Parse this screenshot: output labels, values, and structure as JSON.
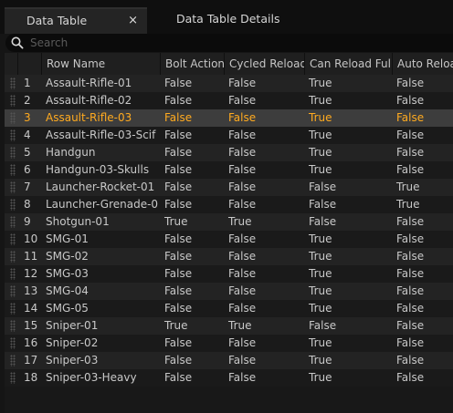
{
  "tabs": [
    {
      "label": "Data Table",
      "close": "×"
    },
    {
      "label": "Data Table Details"
    }
  ],
  "search": {
    "placeholder": "Search",
    "value": ""
  },
  "table": {
    "columns": [
      "Row Name",
      "Bolt Action",
      "Cycled Reload",
      "Can Reload Full",
      "Auto Reload"
    ],
    "selected_index": 2,
    "rows": [
      {
        "idx": "1",
        "name": "Assault-Rifle-01",
        "bolt": "False",
        "cycled": "False",
        "full": "True",
        "auto": "False"
      },
      {
        "idx": "2",
        "name": "Assault-Rifle-02",
        "bolt": "False",
        "cycled": "False",
        "full": "True",
        "auto": "False"
      },
      {
        "idx": "3",
        "name": "Assault-Rifle-03",
        "bolt": "False",
        "cycled": "False",
        "full": "True",
        "auto": "False"
      },
      {
        "idx": "4",
        "name": "Assault-Rifle-03-Scif",
        "bolt": "False",
        "cycled": "False",
        "full": "True",
        "auto": "False"
      },
      {
        "idx": "5",
        "name": "Handgun",
        "bolt": "False",
        "cycled": "False",
        "full": "True",
        "auto": "False"
      },
      {
        "idx": "6",
        "name": "Handgun-03-Skulls",
        "bolt": "False",
        "cycled": "False",
        "full": "True",
        "auto": "False"
      },
      {
        "idx": "7",
        "name": "Launcher-Rocket-01",
        "bolt": "False",
        "cycled": "False",
        "full": "False",
        "auto": "True"
      },
      {
        "idx": "8",
        "name": "Launcher-Grenade-0",
        "bolt": "False",
        "cycled": "False",
        "full": "False",
        "auto": "True"
      },
      {
        "idx": "9",
        "name": "Shotgun-01",
        "bolt": "True",
        "cycled": "True",
        "full": "False",
        "auto": "False"
      },
      {
        "idx": "10",
        "name": "SMG-01",
        "bolt": "False",
        "cycled": "False",
        "full": "True",
        "auto": "False"
      },
      {
        "idx": "11",
        "name": "SMG-02",
        "bolt": "False",
        "cycled": "False",
        "full": "True",
        "auto": "False"
      },
      {
        "idx": "12",
        "name": "SMG-03",
        "bolt": "False",
        "cycled": "False",
        "full": "True",
        "auto": "False"
      },
      {
        "idx": "13",
        "name": "SMG-04",
        "bolt": "False",
        "cycled": "False",
        "full": "True",
        "auto": "False"
      },
      {
        "idx": "14",
        "name": "SMG-05",
        "bolt": "False",
        "cycled": "False",
        "full": "True",
        "auto": "False"
      },
      {
        "idx": "15",
        "name": "Sniper-01",
        "bolt": "True",
        "cycled": "True",
        "full": "False",
        "auto": "False"
      },
      {
        "idx": "16",
        "name": "Sniper-02",
        "bolt": "False",
        "cycled": "False",
        "full": "True",
        "auto": "False"
      },
      {
        "idx": "17",
        "name": "Sniper-03",
        "bolt": "False",
        "cycled": "False",
        "full": "True",
        "auto": "False"
      },
      {
        "idx": "18",
        "name": "Sniper-03-Heavy",
        "bolt": "False",
        "cycled": "False",
        "full": "True",
        "auto": "False"
      }
    ]
  },
  "colors": {
    "selected_text": "#ffaa1f",
    "selected_bg": "#3d3d3d"
  }
}
